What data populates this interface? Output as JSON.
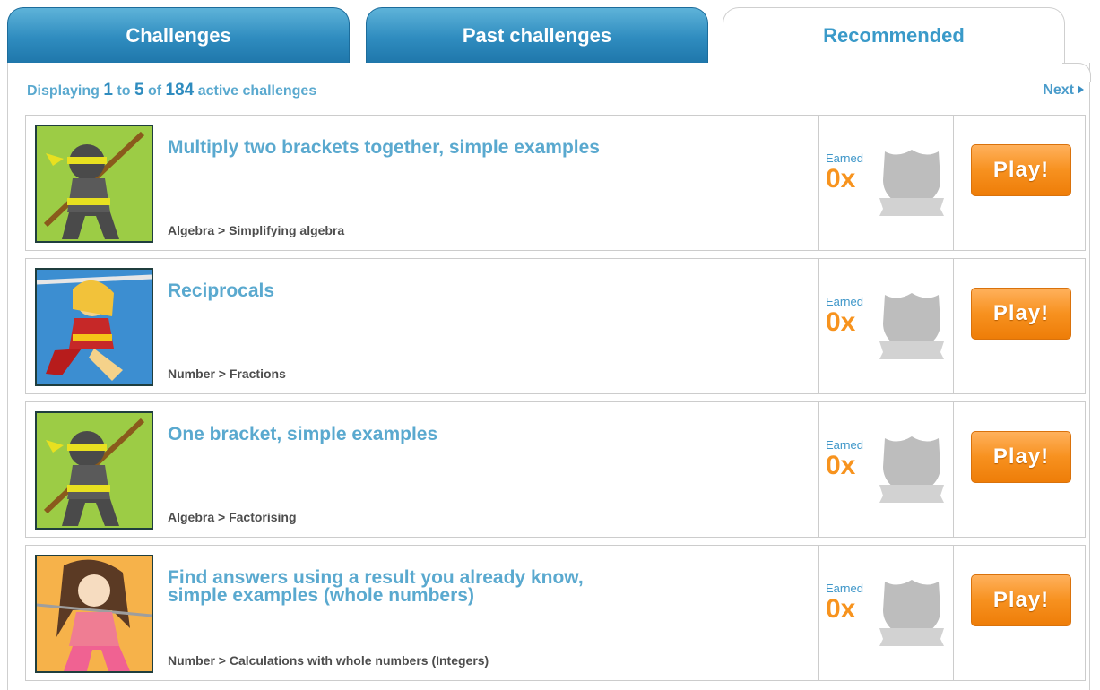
{
  "tabs": [
    {
      "label": "Challenges",
      "state": "inactive"
    },
    {
      "label": "Past challenges",
      "state": "inactive"
    },
    {
      "label": "Recommended",
      "state": "active"
    }
  ],
  "summary": {
    "prefix": "Displaying",
    "from": "1",
    "to_word": "to",
    "to": "5",
    "of_word": "of",
    "total": "184",
    "suffix": "active challenges"
  },
  "pagination": {
    "next_label": "Next"
  },
  "colors": {
    "tab_blue": "#2f8cbf",
    "accent_text": "#5aa9cf",
    "earned_orange": "#f7931e",
    "play_orange": "#f7911f"
  },
  "challenges": [
    {
      "title": "Multiply two brackets together, simple examples",
      "category": "Algebra > Simplifying algebra",
      "earned_label": "Earned",
      "earned_value": "0x",
      "play_label": "Play!",
      "avatar": "ninja-icon"
    },
    {
      "title": "Reciprocals",
      "category": "Number > Fractions",
      "earned_label": "Earned",
      "earned_value": "0x",
      "play_label": "Play!",
      "avatar": "warrior-girl-icon"
    },
    {
      "title": "One bracket, simple examples",
      "category": "Algebra > Factorising",
      "earned_label": "Earned",
      "earned_value": "0x",
      "play_label": "Play!",
      "avatar": "ninja-icon"
    },
    {
      "title": "Find answers using a result you already know, simple examples (whole numbers)",
      "category": "Number > Calculations with whole numbers (Integers)",
      "earned_label": "Earned",
      "earned_value": "0x",
      "play_label": "Play!",
      "avatar": "fighter-girl-icon"
    }
  ]
}
